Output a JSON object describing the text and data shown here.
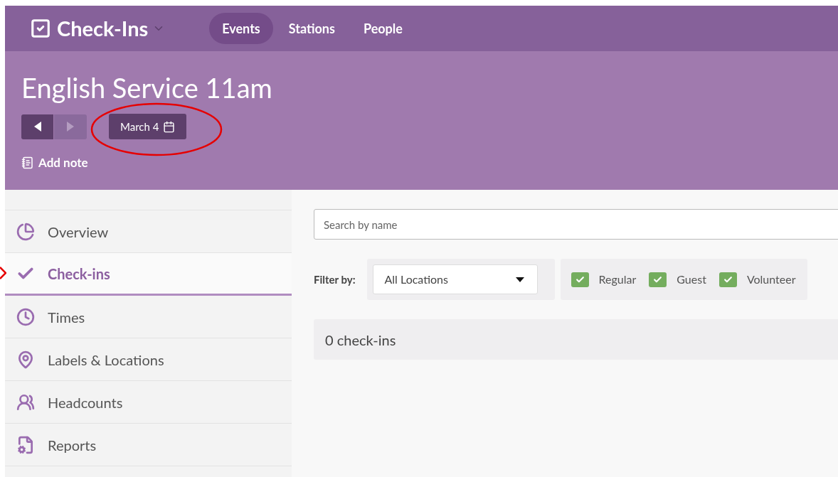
{
  "app": {
    "title": "Check-Ins"
  },
  "tabs": [
    {
      "label": "Events",
      "selected": true
    },
    {
      "label": "Stations",
      "selected": false
    },
    {
      "label": "People",
      "selected": false
    }
  ],
  "event": {
    "title": "English Service 11am",
    "date": "March 4",
    "prev_disabled": false,
    "next_disabled": true,
    "add_note": "Add note"
  },
  "sidebar": {
    "items": [
      {
        "label": "Overview",
        "selected": false
      },
      {
        "label": "Check-ins",
        "selected": true
      },
      {
        "label": "Times",
        "selected": false
      },
      {
        "label": "Labels & Locations",
        "selected": false
      },
      {
        "label": "Headcounts",
        "selected": false
      },
      {
        "label": "Reports",
        "selected": false
      }
    ]
  },
  "search": {
    "placeholder": "Search by name"
  },
  "filter": {
    "label": "Filter by:",
    "location": "All Locations",
    "types": [
      {
        "label": "Regular",
        "checked": true
      },
      {
        "label": "Guest",
        "checked": true
      },
      {
        "label": "Volunteer",
        "checked": true
      }
    ]
  },
  "summary": "0 check-ins"
}
